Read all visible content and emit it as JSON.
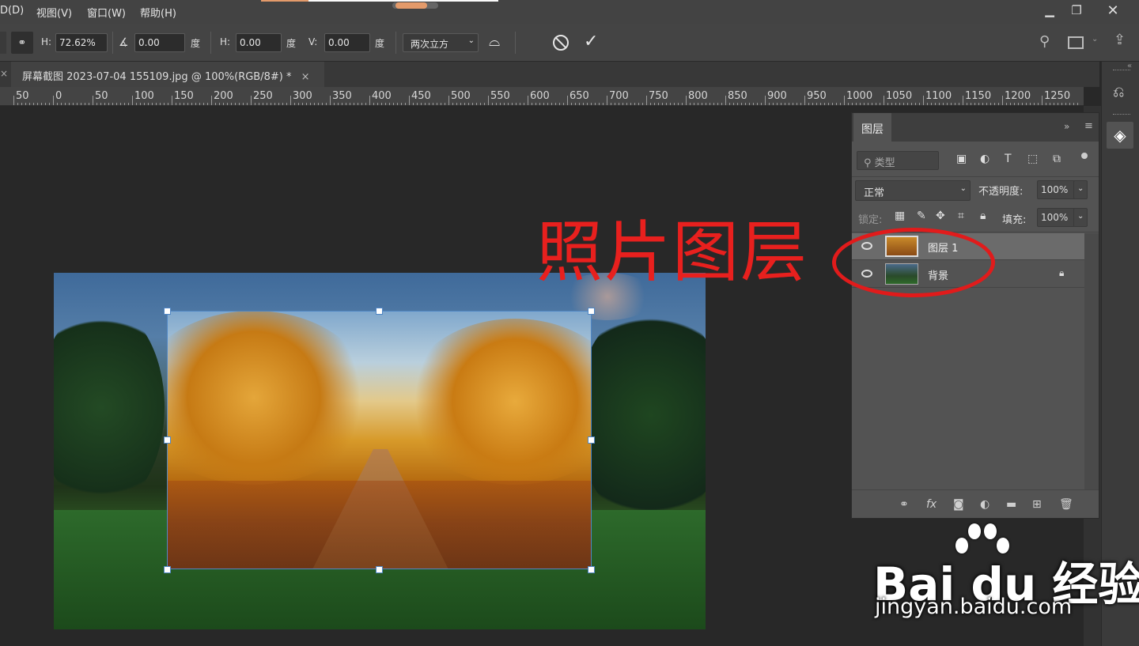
{
  "menubar": {
    "items": [
      "D(D)",
      "视图(V)",
      "窗口(W)",
      "帮助(H)"
    ],
    "window_controls": [
      "minimize-icon",
      "restore-icon",
      "close-icon"
    ]
  },
  "options": {
    "h_label": "H:",
    "h_value": "72.62%",
    "angle_value": "0.00",
    "angle_unit": "度",
    "hskew_label": "H:",
    "hskew_value": "0.00",
    "hskew_unit": "度",
    "vskew_label": "V:",
    "vskew_value": "0.00",
    "vskew_unit": "度",
    "interpolation": "两次立方",
    "cancel_icon": "cancel-icon",
    "commit_icon": "check-icon"
  },
  "document": {
    "tab_title": "屏幕截图 2023-07-04 155109.jpg @ 100%(RGB/8#) *",
    "close_glyph": "×"
  },
  "ruler": {
    "ticks": [
      "50",
      "0",
      "50",
      "100",
      "150",
      "200",
      "250",
      "300",
      "350",
      "400",
      "450",
      "500",
      "550",
      "600",
      "650",
      "700",
      "750",
      "800",
      "850",
      "900",
      "950",
      "1000",
      "1050",
      "1100",
      "1150",
      "1200",
      "1250"
    ]
  },
  "annotation": {
    "text": "照片图层",
    "color": "#e8201e"
  },
  "layers_panel": {
    "tab": "图层",
    "filter_placeholder": "类型",
    "blend_mode": "正常",
    "opacity_label": "不透明度:",
    "opacity_value": "100%",
    "lock_label": "锁定:",
    "fill_label": "填充:",
    "fill_value": "100%",
    "layers": [
      {
        "name": "图层 1",
        "selected": true,
        "locked": false
      },
      {
        "name": "背景",
        "selected": false,
        "locked": true
      }
    ]
  },
  "watermark": {
    "brand": "Bai du 经验",
    "url": "jingyan.baidu.com"
  },
  "colors": {
    "accent_orange": "#e39a6a",
    "highlight_red": "#e11b1b",
    "panel_bg": "#535353"
  }
}
